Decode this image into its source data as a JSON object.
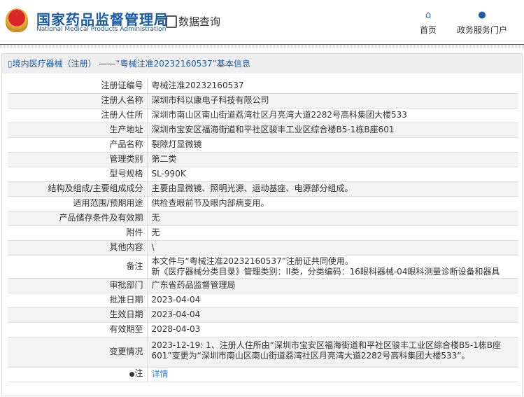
{
  "header": {
    "brand_cn": "国家药品监督管理局",
    "brand_en": "National Medical Products Administration",
    "data_query": "数据查询",
    "nav": [
      {
        "label": "首页",
        "icon": "home-icon"
      },
      {
        "label": "政务服务门户",
        "icon": "user-icon"
      }
    ]
  },
  "title": "境内医疗器械（注册） ——“粤械注准20232160537”基本信息",
  "rows": [
    {
      "label": "注册证编号",
      "value": "粤械注准20232160537"
    },
    {
      "label": "注册人名称",
      "value": "深圳市科以康电子科技有限公司"
    },
    {
      "label": "注册人住所",
      "value": "深圳市南山区南山街道荔湾社区月亮湾大道2282号高科集团大楼533"
    },
    {
      "label": "生产地址",
      "value": "深圳市宝安区福海街道和平社区骏丰工业区综合楼B5-1栋B座601"
    },
    {
      "label": "产品名称",
      "value": "裂隙灯显微镜"
    },
    {
      "label": "管理类别",
      "value": "第二类"
    },
    {
      "label": "型号规格",
      "value": "SL-990K"
    },
    {
      "label": "结构及组成/主要组成成分",
      "value": "主要由显微镜、照明光源、运动基座、电源部分组成。"
    },
    {
      "label": "适用范围/预期用途",
      "value": "供检查眼前节及眼内部病变用。"
    },
    {
      "label": "产品储存条件及有效期",
      "value": "无"
    },
    {
      "label": "附件",
      "value": "无"
    },
    {
      "label": "其他内容",
      "value": "\\"
    },
    {
      "label": "备注",
      "value": "本文件与“粤械注准20232160537”注册证共同使用。",
      "value2": "新《医疗器械分类目录》管理类别：II类，分类编码：16眼科器械-04眼科测量诊断设备和器具"
    },
    {
      "label": "审批部门",
      "value": "广东省药品监督管理局"
    },
    {
      "label": "批准日期",
      "value": "2023-04-04"
    },
    {
      "label": "生效日期",
      "value": "2023-04-04"
    },
    {
      "label": "有效期至",
      "value": "2028-04-03"
    },
    {
      "label": "变更情况",
      "value": "2023-12-19: 1、注册人住所由“深圳市宝安区福海街道和平社区骏丰工业区综合楼B5-1栋B座601”变更为“深圳市南山区南山街道荔湾社区月亮湾大道2282号高科集团大楼533”。"
    },
    {
      "label": "注",
      "value": "详情"
    }
  ]
}
